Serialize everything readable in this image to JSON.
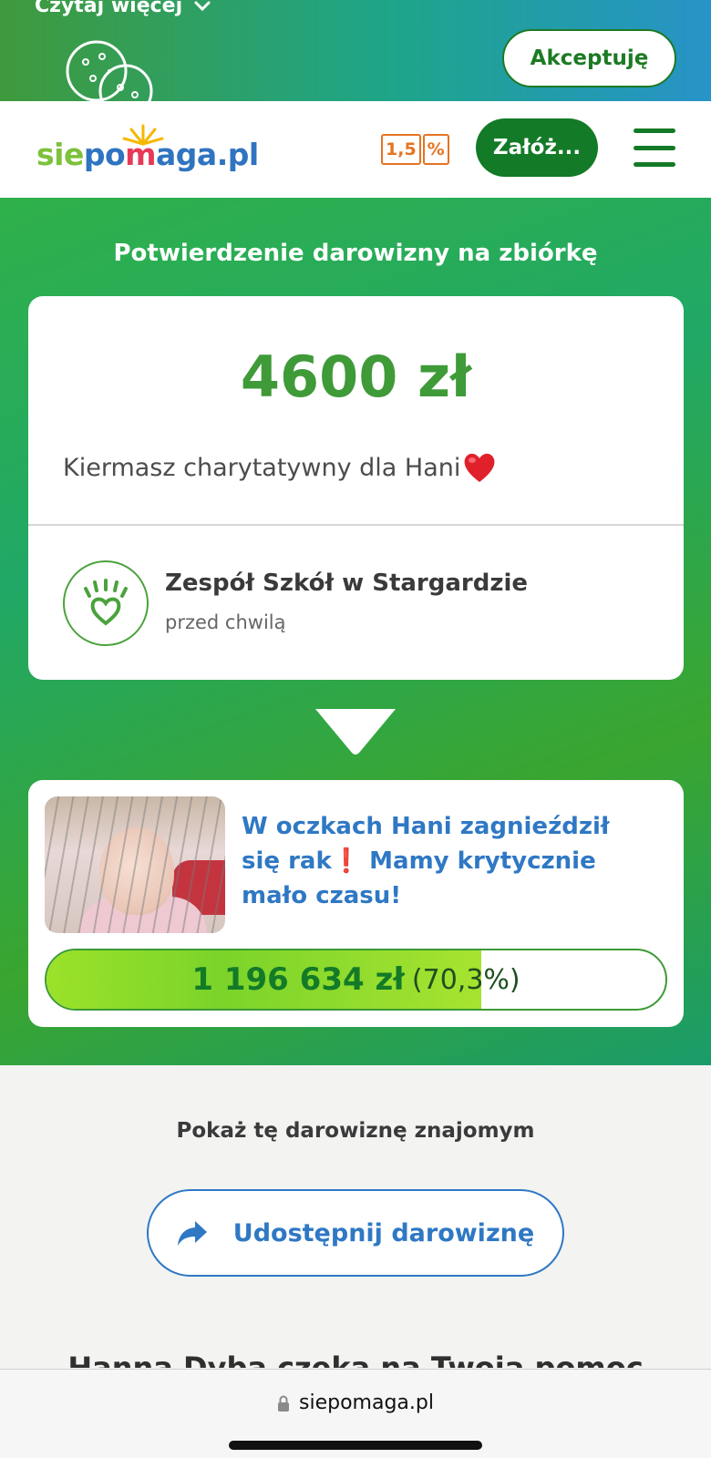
{
  "cookie_banner": {
    "read_more_label": "Czytaj więcej",
    "accept_label": "Akceptuję"
  },
  "header": {
    "logo": {
      "part_sie": "sie",
      "part_po": "po",
      "part_heart": "m",
      "part_aga": "aga",
      "part_pl": ".pl"
    },
    "percent_badge": [
      "1,5",
      "%"
    ],
    "found_button_label": "Załóż..."
  },
  "confirmation": {
    "title": "Potwierdzenie darowizny na zbiórkę",
    "amount": "4600 zł",
    "fundraiser_name": "Kiermasz charytatywny dla Hani",
    "donor_name": "Zespół Szkół w Stargardzie",
    "donor_time": "przed chwilą"
  },
  "fundraiser_card": {
    "title": "W oczkach Hani zagnieździł się rak❗ Mamy krytycznie mało czasu!",
    "raised_amount": "1 196 634 zł",
    "raised_percent_label": "(70,3%)",
    "progress_fraction": 0.703
  },
  "share": {
    "heading": "Pokaż tę darowiznę znajomym",
    "button_label": "Udostępnij darowiznę"
  },
  "next_section": {
    "heading": "Hanna Dyba czeka na Twoją pomoc"
  },
  "browser": {
    "url": "siepomaga.pl"
  },
  "colors": {
    "brand_green": "#137a27",
    "amount_green": "#3f9a38",
    "link_blue": "#2f78c4",
    "badge_orange": "#e57422"
  }
}
